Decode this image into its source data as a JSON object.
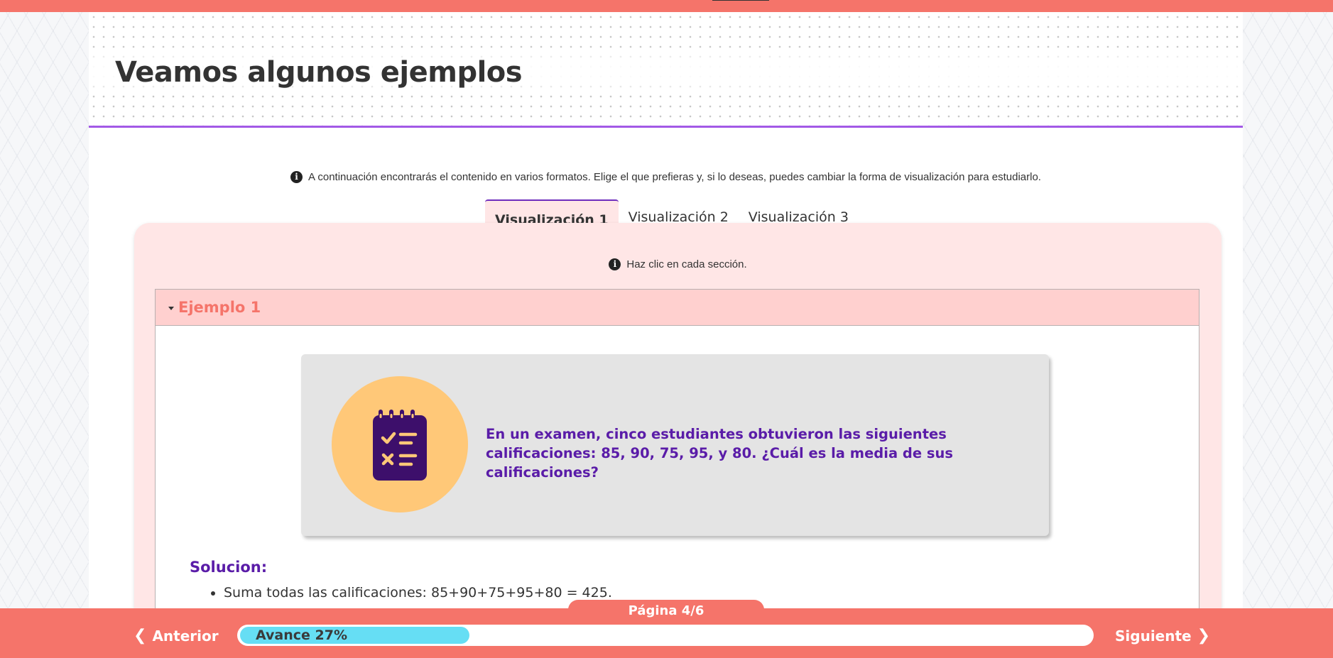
{
  "header": {
    "title": "Veamos algunos ejemplos"
  },
  "info": {
    "icon": "info-circle-icon",
    "text": "A continuación encontrarás el contenido en varios formatos. Elige el que prefieras y, si lo deseas, puedes cambiar la forma de visualización para estudiarlo."
  },
  "tabs": [
    {
      "label": "Visualización 1",
      "active": true
    },
    {
      "label": "Visualización 2",
      "active": false
    },
    {
      "label": "Visualización 3",
      "active": false
    }
  ],
  "panel": {
    "hint": "Haz clic en cada sección.",
    "accordion": {
      "title": "Ejemplo 1",
      "expanded": true
    },
    "problem": {
      "icon": "clipboard-checklist-icon",
      "text": "En un examen, cinco estudiantes obtuvieron las siguientes calificaciones: 85, 90, 75, 95, y 80. ¿Cuál es la media de sus calificaciones?"
    },
    "solution": {
      "title": "Solucion:",
      "steps": [
        "Suma todas las calificaciones: 85+90+75+95+80 = 425."
      ]
    }
  },
  "footer": {
    "page": "Página 4/6",
    "prev_label": "Anterior",
    "next_label": "Siguiente",
    "progress_label": "Avance 27%",
    "progress_percent": 27
  },
  "colors": {
    "accent": "#f5746a",
    "purple": "#5a1ca8",
    "progress": "#66def4",
    "tab_bg": "#ffe6e6"
  }
}
